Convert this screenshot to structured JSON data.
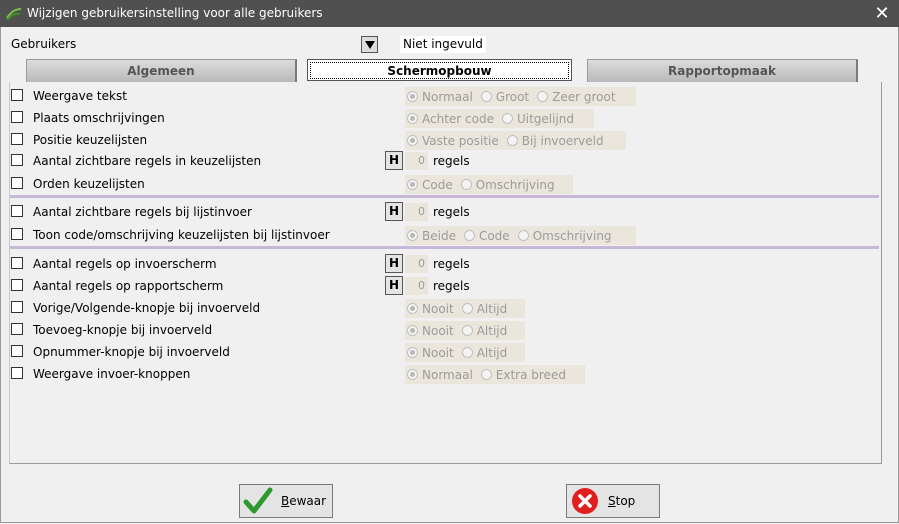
{
  "window": {
    "title": "Wijzigen gebruikersinstelling voor alle gebruikers",
    "close_glyph": "✕"
  },
  "users": {
    "label": "Gebruikers",
    "value": "Niet ingevuld"
  },
  "tabs": [
    {
      "label": "Algemeen"
    },
    {
      "label": "Schermopbouw"
    },
    {
      "label": "Rapportopmaak"
    }
  ],
  "rows": [
    {
      "label": "Weergave tekst",
      "options": [
        "Normaal",
        "Groot",
        "Zeer groot"
      ]
    },
    {
      "label": "Plaats omschrijvingen",
      "options": [
        "Achter code",
        "Uitgelijnd"
      ]
    },
    {
      "label": "Positie keuzelijsten",
      "options": [
        "Vaste positie",
        "Bij invoerveld"
      ]
    },
    {
      "label": "Aantal zichtbare regels in keuzelijsten",
      "h": "H",
      "number": "0",
      "unit": "regels"
    },
    {
      "label": "Orden keuzelijsten",
      "options": [
        "Code",
        "Omschrijving"
      ]
    },
    {
      "label": "Aantal zichtbare regels bij lijstinvoer",
      "h": "H",
      "number": "0",
      "unit": "regels"
    },
    {
      "label": "Toon code/omschrijving keuzelijsten bij lijstinvoer",
      "options": [
        "Beide",
        "Code",
        "Omschrijving"
      ]
    },
    {
      "label": "Aantal regels op invoerscherm",
      "h": "H",
      "number": "0",
      "unit": "regels"
    },
    {
      "label": "Aantal regels op rapportscherm",
      "h": "H",
      "number": "0",
      "unit": "regels"
    },
    {
      "label": "Vorige/Volgende-knopje bij invoerveld",
      "options": [
        "Nooit",
        "Altijd"
      ]
    },
    {
      "label": "Toevoeg-knopje bij invoerveld",
      "options": [
        "Nooit",
        "Altijd"
      ]
    },
    {
      "label": "Opnummer-knopje bij invoerveld",
      "options": [
        "Nooit",
        "Altijd"
      ]
    },
    {
      "label": "Weergave invoer-knoppen",
      "options": [
        "Normaal",
        "Extra breed"
      ]
    }
  ],
  "buttons": {
    "save": {
      "label_first": "B",
      "label_rest": "ewaar",
      "icon": "checkmark-icon",
      "color": "#2e9a2e"
    },
    "stop": {
      "label_first": "S",
      "label_rest": "top",
      "icon": "stop-x-icon",
      "color": "#e02020"
    }
  },
  "colors": {
    "titlebar": "#505050",
    "disabled_option_bg": "#ebe6dc",
    "divider": "#c8b8d8"
  }
}
